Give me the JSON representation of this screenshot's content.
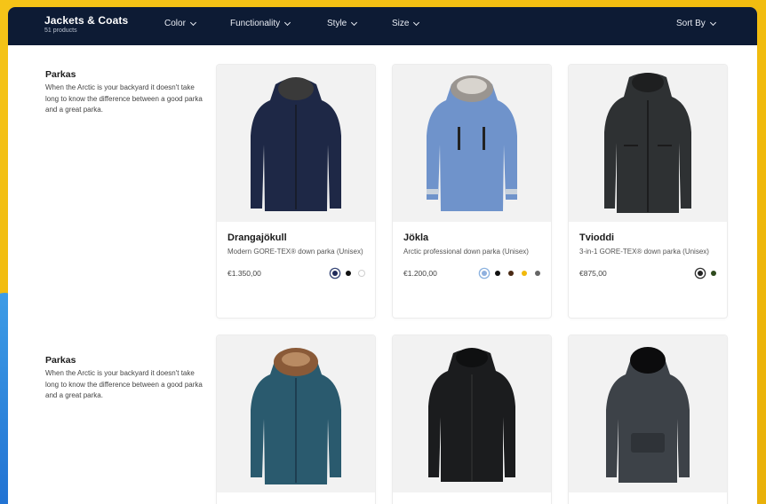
{
  "header": {
    "title": "Jackets & Coats",
    "subtitle": "51 products",
    "filters": [
      "Color",
      "Functionality",
      "Style",
      "Size"
    ],
    "sort_label": "Sort By"
  },
  "sections": [
    {
      "title": "Parkas",
      "text": "When the Arctic is your backyard it doesn't take long to know the difference between a good parka and a great parka."
    },
    {
      "title": "Parkas",
      "text": "When the Arctic is your backyard it doesn't take long to know the difference between a good parka and a great parka."
    }
  ],
  "products": [
    {
      "name": "Drangajökull",
      "description": "Modern GORE-TEX® down parka (Unisex)",
      "price": "€1.350,00",
      "jacket_color": "#1e2846",
      "swatches": [
        "#1f2a5a",
        "#111111",
        "#ffffff"
      ]
    },
    {
      "name": "Jökla",
      "description": "Arctic professional down parka (Unisex)",
      "price": "€1.200,00",
      "jacket_color": "#6f93cb",
      "swatches": [
        "#8fb0de",
        "#111111",
        "#4a2a14",
        "#f1b90c",
        "#666666"
      ]
    },
    {
      "name": "Tvioddi",
      "description": "3-in-1 GORE-TEX® down parka (Unisex)",
      "price": "€875,00",
      "jacket_color": "#2e3133",
      "swatches": [
        "#222222",
        "#2f4a1e"
      ]
    },
    {
      "jacket_color": "#2a5a6e"
    },
    {
      "jacket_color": "#1b1c1e"
    },
    {
      "jacket_color": "#3d4248"
    }
  ],
  "colors": {
    "header_bg": "#0d1b34",
    "frame_yellow": "#f5c418"
  }
}
